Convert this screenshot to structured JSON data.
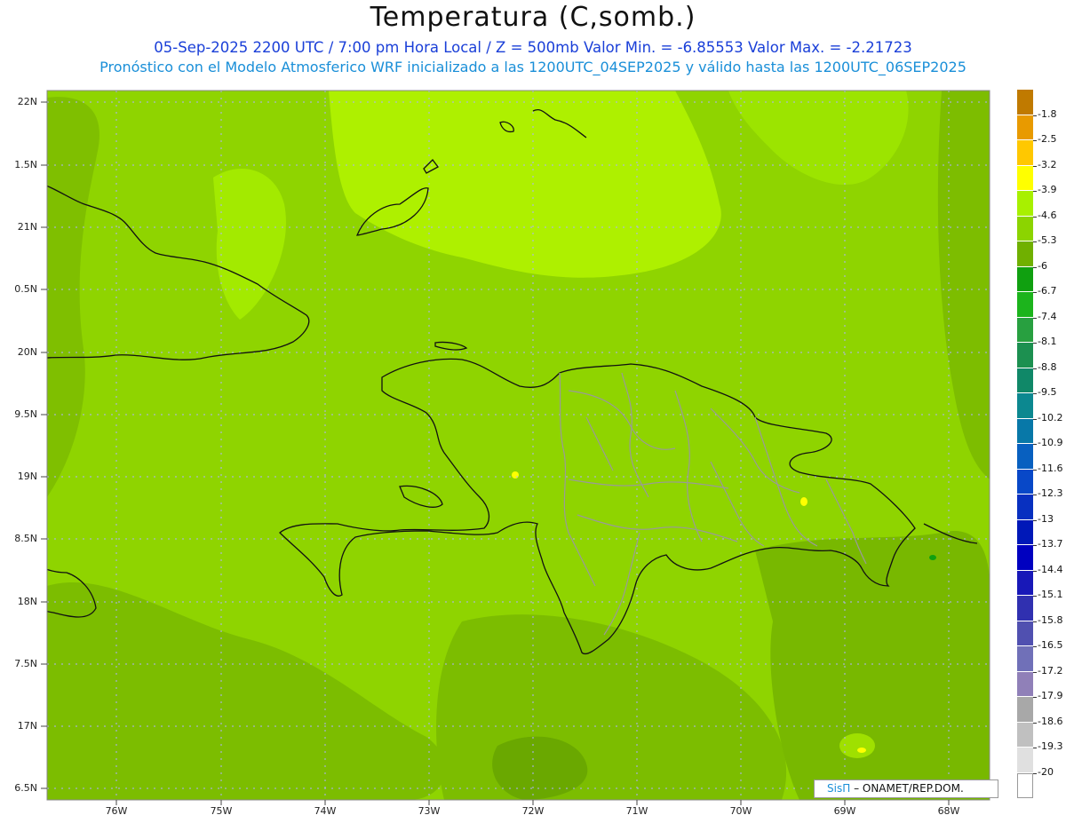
{
  "header": {
    "title": "Temperatura (C,somb.)",
    "line1": "05-Sep-2025  2200 UTC / 7:00 pm Hora Local / Z = 500mb  Valor Min. = -6.85553  Valor Max. = -2.21723",
    "line2": "Pronóstico con el Modelo Atmosferico WRF inicializado a las 1200UTC_04SEP2025 y válido hasta las  1200UTC_06SEP2025"
  },
  "map": {
    "background_color": "#8fd400",
    "lat_labels": [
      "22N",
      "1.5N",
      "21N",
      "0.5N",
      "20N",
      "9.5N",
      "19N",
      "8.5N",
      "18N",
      "7.5N",
      "17N",
      "6.5N"
    ],
    "lon_labels": [
      "76W",
      "75W",
      "74W",
      "73W",
      "72W",
      "71W",
      "70W",
      "69W",
      "68W"
    ]
  },
  "colorbar": {
    "labels": [
      "-1.8",
      "-2.5",
      "-3.2",
      "-3.9",
      "-4.6",
      "-5.3",
      "-6",
      "-6.7",
      "-7.4",
      "-8.1",
      "-8.8",
      "-9.5",
      "-10.2",
      "-10.9",
      "-11.6",
      "-12.3",
      "-13",
      "-13.7",
      "-14.4",
      "-15.1",
      "-15.8",
      "-16.5",
      "-17.2",
      "-17.9",
      "-18.6",
      "-19.3",
      "-20"
    ],
    "colors": [
      "#c07a00",
      "#e89a00",
      "#ffc800",
      "#ffff00",
      "#a8f000",
      "#8cd400",
      "#70b000",
      "#10a010",
      "#1cb41c",
      "#28a040",
      "#1c9050",
      "#108868",
      "#0c8890",
      "#0878a8",
      "#0860c0",
      "#0848c8",
      "#0830c0",
      "#0018b8",
      "#0000c0",
      "#1818b8",
      "#3030b0",
      "#5050b0",
      "#7070b8",
      "#9080b8",
      "#a8a8a8",
      "#c0c0c0",
      "#e0e0e0",
      "#ffffff"
    ]
  },
  "credit": {
    "brand": "SisΠ",
    "text": "– ONAMET/REP.DOM."
  }
}
